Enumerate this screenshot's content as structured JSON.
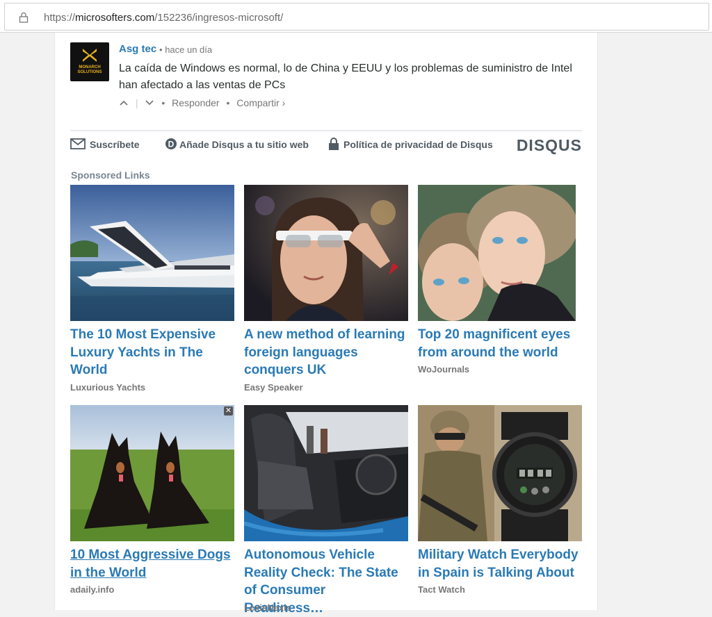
{
  "browser": {
    "url_scheme": "https://",
    "url_domain": "microsofters.com",
    "url_path": "/152236/ingresos-microsoft/"
  },
  "comment": {
    "avatar_text": "MONARCH SOLUTIONS",
    "author": "Asg tec",
    "separator": "•",
    "time": "hace un día",
    "text": "La caída de Windows es normal, lo de China y EEUU y los problemas de suministro de Intel han afectado a las ventas de PCs",
    "upvote_icon": "chevron-up-icon",
    "downvote_icon": "chevron-down-icon",
    "reply_label": "Responder",
    "share_label": "Compartir ›"
  },
  "disqus_footer": {
    "subscribe_label": "Suscríbete",
    "add_disqus_label": "Añade Disqus a tu sitio web",
    "privacy_label": "Política de privacidad de Disqus",
    "logo_text": "DISQUS"
  },
  "sponsored": {
    "heading": "Sponsored Links",
    "items": [
      {
        "title": "The 10 Most Expensive Luxury Yachts in The World",
        "source": "Luxurious Yachts",
        "image": "yacht"
      },
      {
        "title": "A new method of learning foreign languages conquers UK",
        "source": "Easy Speaker",
        "image": "woman-smart-glasses"
      },
      {
        "title": "Top 20 magnificent eyes from around the world",
        "source": "WoJournals",
        "image": "two-children"
      },
      {
        "title": "10 Most Aggressive Dogs in the World",
        "source": "adaily.info",
        "image": "doberman-dogs"
      },
      {
        "title": "Autonomous Vehicle Reality Check: The State of Consumer Readiness…",
        "source": "LexisNexis",
        "image": "car-interior"
      },
      {
        "title": "Military Watch Everybody in Spain is Talking About",
        "source": "Tact Watch",
        "image": "soldier-watch"
      }
    ]
  },
  "colors": {
    "link": "#2a7ab5",
    "muted": "#777777",
    "footer_text": "#4f5a63"
  }
}
